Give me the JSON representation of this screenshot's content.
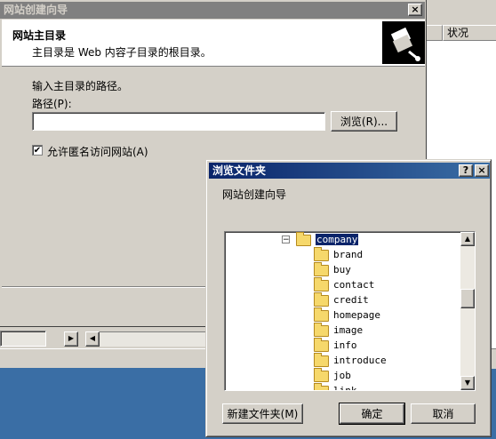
{
  "wizard": {
    "title": "网站创建向导",
    "close": "×",
    "header_title": "网站主目录",
    "header_subtitle": "主目录是 Web 内容子目录的根目录。",
    "prompt": "输入主目录的路径。",
    "path_label": "路径(P):",
    "path_value": "",
    "browse_label": "浏览(R)...",
    "anon_label": "允许匿名访问网站(A)",
    "anon_checked": true
  },
  "background_window": {
    "column_header": "状况"
  },
  "browse_dialog": {
    "title": "浏览文件夹",
    "help": "?",
    "close": "×",
    "description": "网站创建向导",
    "tree": {
      "expanded_folder": "company",
      "expander": "−",
      "children": [
        "brand",
        "buy",
        "contact",
        "credit",
        "homepage",
        "image",
        "info",
        "introduce",
        "job",
        "link"
      ]
    },
    "new_folder_label": "新建文件夹(M)",
    "ok_label": "确定",
    "cancel_label": "取消"
  }
}
